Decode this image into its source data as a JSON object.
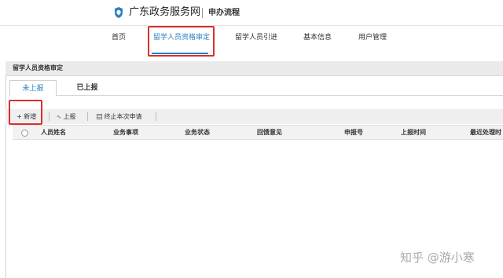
{
  "header": {
    "logo_icon": "guangdong-emblem-icon",
    "brand": "广东政务服务网",
    "subtitle": "申办流程"
  },
  "nav": {
    "items": [
      {
        "label": "首页"
      },
      {
        "label": "留学人员资格审定",
        "active": true
      },
      {
        "label": "留学人员引进"
      },
      {
        "label": "基本信息"
      },
      {
        "label": "用户管理"
      }
    ]
  },
  "panel": {
    "title": "留学人员资格审定",
    "tabs": [
      {
        "label": "未上报",
        "active": true
      },
      {
        "label": "已上报"
      }
    ]
  },
  "toolbar": {
    "add_label": "+ 新增",
    "report_label": "上报",
    "report_icon": "report-icon",
    "terminate_label": "终止本次申请",
    "terminate_icon": "document-icon"
  },
  "table": {
    "columns": [
      "人员姓名",
      "业务事项",
      "业务状态",
      "回馈意见",
      "申报号",
      "上报时间",
      "最近处理时"
    ]
  },
  "watermark": "知乎 @游小寒",
  "colors": {
    "accent": "#2a7fc1",
    "highlight_box": "#d9302c"
  }
}
